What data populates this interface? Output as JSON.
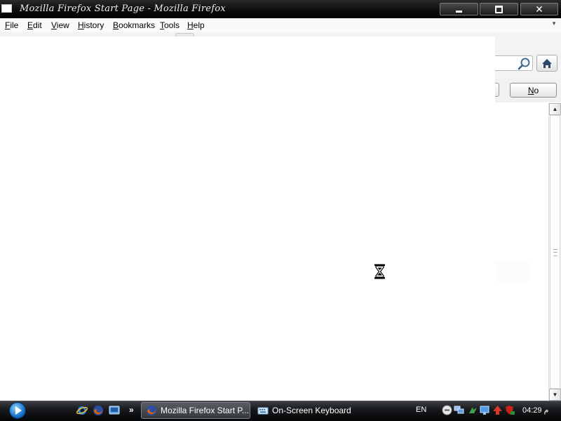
{
  "window": {
    "title": "Mozilla Firefox Start Page - Mozilla Firefox",
    "close_glyph": "✕"
  },
  "menu": {
    "items": [
      {
        "label": "File",
        "accel": "F",
        "rest": "ile"
      },
      {
        "label": "Edit",
        "accel": "E",
        "rest": "dit"
      },
      {
        "label": "View",
        "accel": "V",
        "rest": "iew"
      },
      {
        "label": "History",
        "accel": "H",
        "rest": "istory"
      },
      {
        "label": "Bookmarks",
        "accel": "B",
        "rest": "ookmarks"
      },
      {
        "label": "Tools",
        "accel": "T",
        "rest": "ools"
      },
      {
        "label": "Help",
        "accel": "H",
        "rest": "elp"
      }
    ],
    "overflow_glyph": "▼"
  },
  "notification": {
    "no_button": {
      "label": "No",
      "accel": "N",
      "rest": "o"
    }
  },
  "scrollbar": {
    "up_glyph": "▲",
    "down_glyph": "▼"
  },
  "taskbar": {
    "quick_launch_more": "»",
    "tasks": [
      {
        "label": "Mozilla Firefox Start P...",
        "active": true
      },
      {
        "label": "On-Screen Keyboard",
        "active": false
      }
    ],
    "language": "EN",
    "clock": "04:29 م"
  },
  "colors": {
    "titlebar": "#000000",
    "taskbar": "#15171a",
    "start_orb": "#1673c9",
    "firefox_orange": "#e66000"
  }
}
